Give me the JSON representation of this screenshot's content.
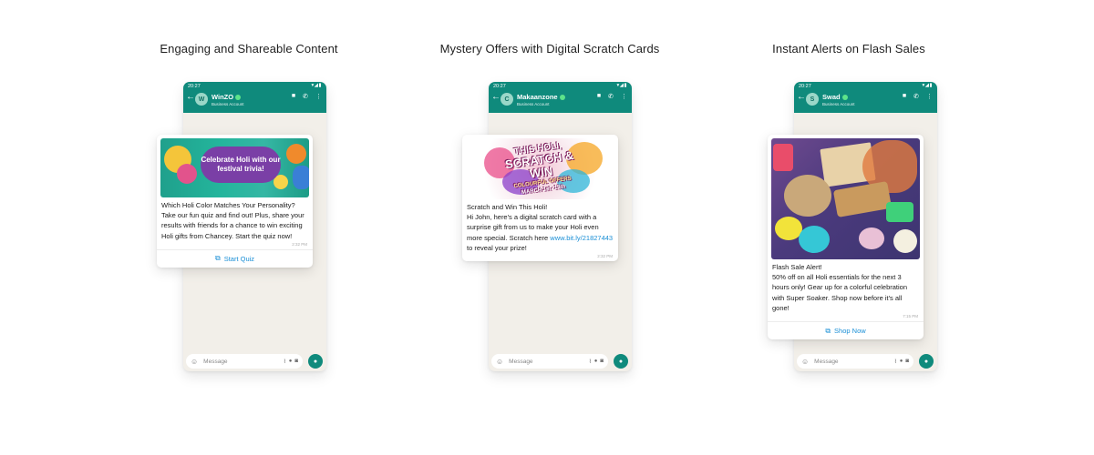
{
  "panels": [
    {
      "title": "Engaging and Shareable Content",
      "phone": {
        "time": "20:27",
        "contact_name": "WinZO",
        "avatar_letter": "W",
        "account_type": "Business Account",
        "input_placeholder": "Message"
      },
      "card": {
        "image_text": "Celebrate Holi with our festival trivia!",
        "text": "Which Holi Color Matches Your Personality?\nTake our fun quiz and find out! Plus, share your results with friends for a chance to win exciting Holi gifts from Chancey. Start the quiz now!",
        "time": "2:32 PM",
        "cta_label": "Start Quiz"
      }
    },
    {
      "title": "Mystery Offers with Digital Scratch Cards",
      "phone": {
        "time": "20:27",
        "contact_name": "Makaanzone",
        "avatar_letter": "C",
        "account_type": "Business Account",
        "input_placeholder": "Message"
      },
      "card": {
        "image_lines": [
          "THIS HOLI,",
          "SCRATCH & WIN",
          "COLOURFUL OFFERS",
          "MARCH 1st -13th"
        ],
        "text_before_link": "Scratch and Win This Holi!\nHi John, here's a digital scratch card with a surprise gift from us to make your Holi even more special. Scratch here ",
        "link": "www.bit.ly/21827443",
        "text_after_link": " to reveal your prize!",
        "time": "2:32 PM"
      }
    },
    {
      "title": "Instant Alerts on Flash Sales",
      "phone": {
        "time": "20:27",
        "contact_name": "Swad",
        "avatar_letter": "S",
        "account_type": "Business Account",
        "input_placeholder": "Message"
      },
      "card": {
        "text": "Flash Sale Alert!\n50% off on all Holi essentials for the next 3 hours only! Gear up for a colorful celebration with Super Soaker. Shop now before it's all gone!",
        "time": "7:15 PM",
        "cta_label": "Shop Now"
      }
    }
  ],
  "icons": {
    "back": "arrow-left-icon",
    "video": "video-call-icon",
    "call": "phone-call-icon",
    "menu": "kebab-menu-icon",
    "emoji": "emoji-icon",
    "attach": "paperclip-icon",
    "payment": "rupee-icon",
    "camera": "camera-icon",
    "mic": "microphone-icon",
    "external": "external-link-icon"
  },
  "colors": {
    "whatsapp_header": "#0f8a7c",
    "link": "#1a8fd6",
    "chat_bg": "#f2efe9"
  }
}
